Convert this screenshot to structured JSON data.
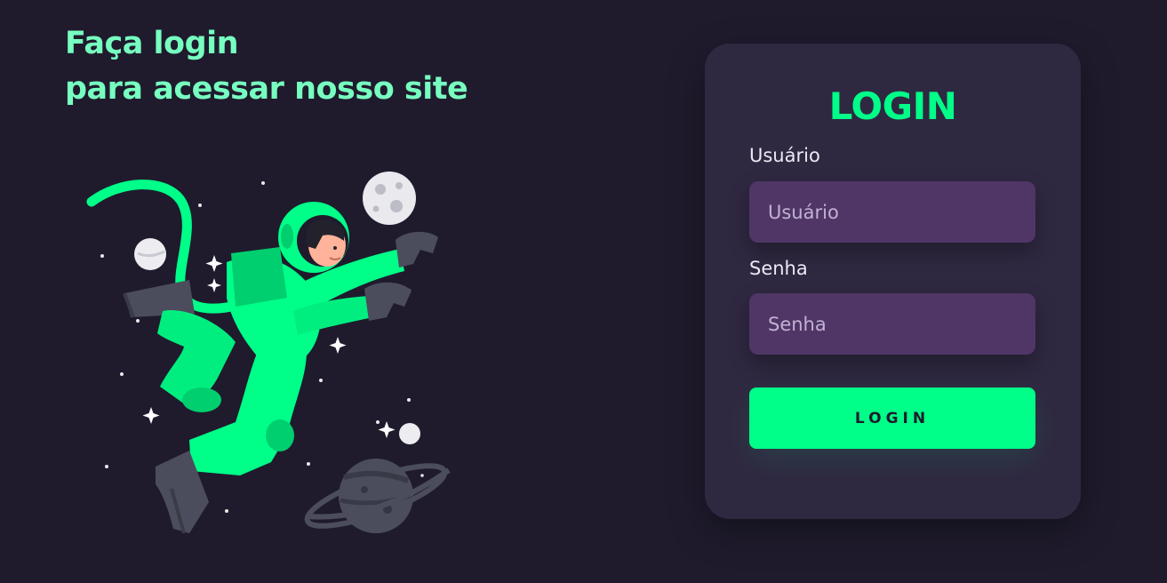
{
  "headline": {
    "line1": "Faça login",
    "line2": "para acessar nosso site"
  },
  "login_card": {
    "title": "LOGIN",
    "username_label": "Usuário",
    "username_placeholder": "Usuário",
    "password_label": "Senha",
    "password_placeholder": "Senha",
    "submit_label": "LOGIN"
  },
  "colors": {
    "background": "#1f1b2d",
    "card": "#2f2841",
    "accent": "#00ff88",
    "headline": "#77ffc0",
    "input": "#503667"
  }
}
